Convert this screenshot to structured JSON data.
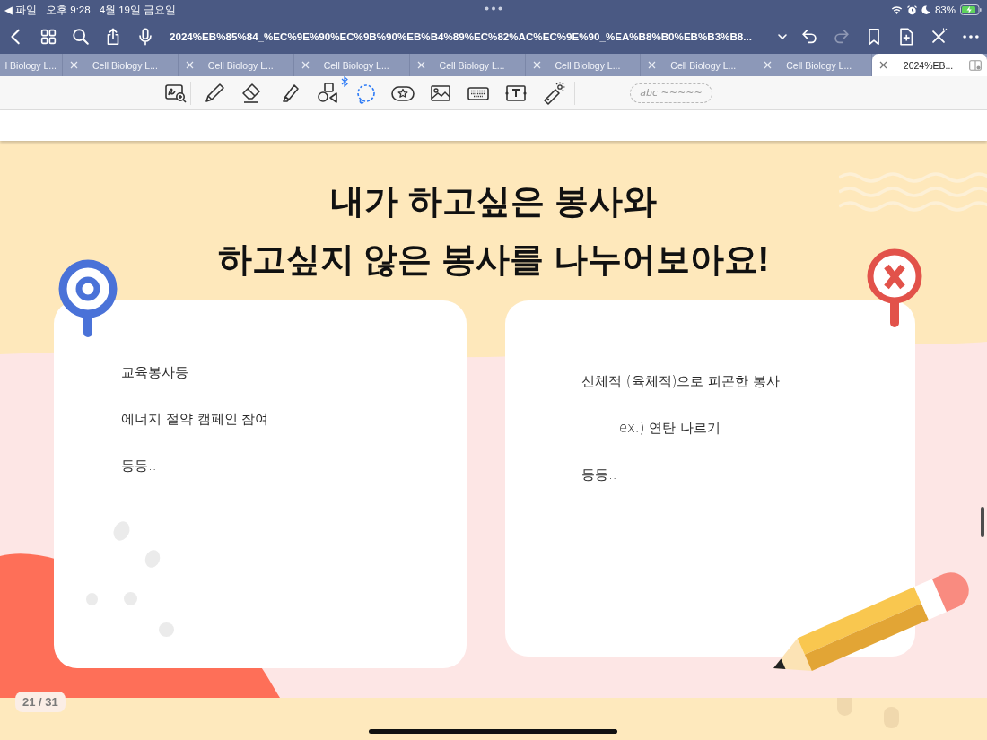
{
  "status_bar": {
    "back_label": "◀ 파일",
    "time": "오후 9:28",
    "date": "4월 19일 금요일",
    "battery": "83%"
  },
  "nav_bar": {
    "title": "2024%EB%85%84_%EC%9E%90%EC%9B%90%EB%B4%89%EC%82%AC%EC%9E%90_%EA%B8%B0%EB%B3%B8...",
    "undo": {
      "disabled": false
    },
    "redo": {
      "disabled": true
    }
  },
  "tabs": [
    {
      "label": "l Biology L...",
      "selected": false,
      "cut_off": true
    },
    {
      "label": "Cell Biology L...",
      "selected": false,
      "cut_off": false
    },
    {
      "label": "Cell Biology L...",
      "selected": false,
      "cut_off": false
    },
    {
      "label": "Cell Biology L...",
      "selected": false,
      "cut_off": false
    },
    {
      "label": "Cell Biology L...",
      "selected": false,
      "cut_off": false
    },
    {
      "label": "Cell Biology L...",
      "selected": false,
      "cut_off": false
    },
    {
      "label": "Cell Biology L...",
      "selected": false,
      "cut_off": false
    },
    {
      "label": "Cell Biology L...",
      "selected": false,
      "cut_off": false
    },
    {
      "label": "2024%EB...",
      "selected": true,
      "cut_off": false
    }
  ],
  "toolbar": {
    "tools": [
      {
        "kind": "zoom",
        "selected": false
      },
      {
        "kind": "pen",
        "selected": false
      },
      {
        "kind": "eraser",
        "selected": false
      },
      {
        "kind": "highlighter",
        "selected": false
      },
      {
        "kind": "shapes",
        "selected": false
      },
      {
        "kind": "lasso",
        "selected": true
      },
      {
        "kind": "sticker",
        "selected": false
      },
      {
        "kind": "image",
        "selected": false
      },
      {
        "kind": "keyboard",
        "selected": false
      },
      {
        "kind": "text",
        "selected": false
      },
      {
        "kind": "laser",
        "selected": false
      }
    ],
    "handwriting_field": {
      "placeholder": "abc ~~~~~"
    }
  },
  "page": {
    "title_lines": [
      "내가 하고싶은 봉사와",
      "하고싶지 않은 봉사를 나누어보아요!"
    ],
    "cards": [
      {
        "kind": "yes",
        "color": "#4a72d8",
        "notes": [
          {
            "text": "교육봉사등"
          },
          {
            "text": "에너지 절약 캠페인 참여"
          },
          {
            "text": "등등.."
          }
        ]
      },
      {
        "kind": "no",
        "color": "#e2524a",
        "notes": [
          {
            "text": "신체적 (육체적)으로 피곤한 봉사.",
            "children": [
              {
                "text": "ex.) 연탄 나르기"
              }
            ]
          },
          {
            "text": "등등.."
          }
        ]
      }
    ]
  },
  "page_indicator": "21 / 31"
}
